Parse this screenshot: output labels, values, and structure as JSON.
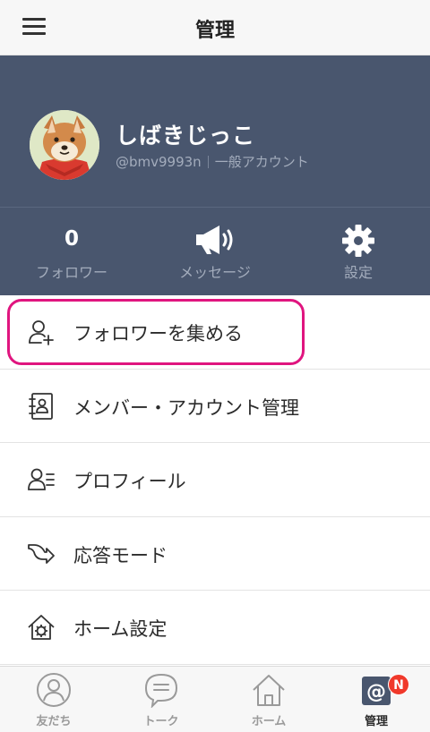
{
  "header": {
    "title": "管理",
    "menu_icon": "hamburger-icon"
  },
  "profile": {
    "name": "しばきじっこ",
    "id": "@bmv9993n",
    "account_type": "一般アカウント",
    "avatar": "shiba-dog-avatar"
  },
  "stats": {
    "followers": {
      "value": "0",
      "label": "フォロワー"
    },
    "message": {
      "label": "メッセージ",
      "icon": "megaphone-icon"
    },
    "settings": {
      "label": "設定",
      "icon": "gear-icon"
    }
  },
  "menu": {
    "items": [
      {
        "label": "フォロワーを集める",
        "icon": "add-user-icon",
        "highlighted": true
      },
      {
        "label": "メンバー・アカウント管理",
        "icon": "address-book-icon"
      },
      {
        "label": "プロフィール",
        "icon": "profile-icon"
      },
      {
        "label": "応答モード",
        "icon": "reply-arrow-icon"
      },
      {
        "label": "ホーム設定",
        "icon": "home-gear-icon"
      }
    ]
  },
  "tabs": {
    "items": [
      {
        "label": "友だち",
        "icon": "person-icon"
      },
      {
        "label": "トーク",
        "icon": "chat-icon"
      },
      {
        "label": "ホーム",
        "icon": "home-icon"
      },
      {
        "label": "管理",
        "icon": "at-icon",
        "active": true,
        "badge": "N"
      }
    ]
  },
  "colors": {
    "header_bg": "#f7f7f7",
    "profile_bg": "#49566e",
    "highlight": "#e0157f",
    "badge": "#f0392b"
  }
}
